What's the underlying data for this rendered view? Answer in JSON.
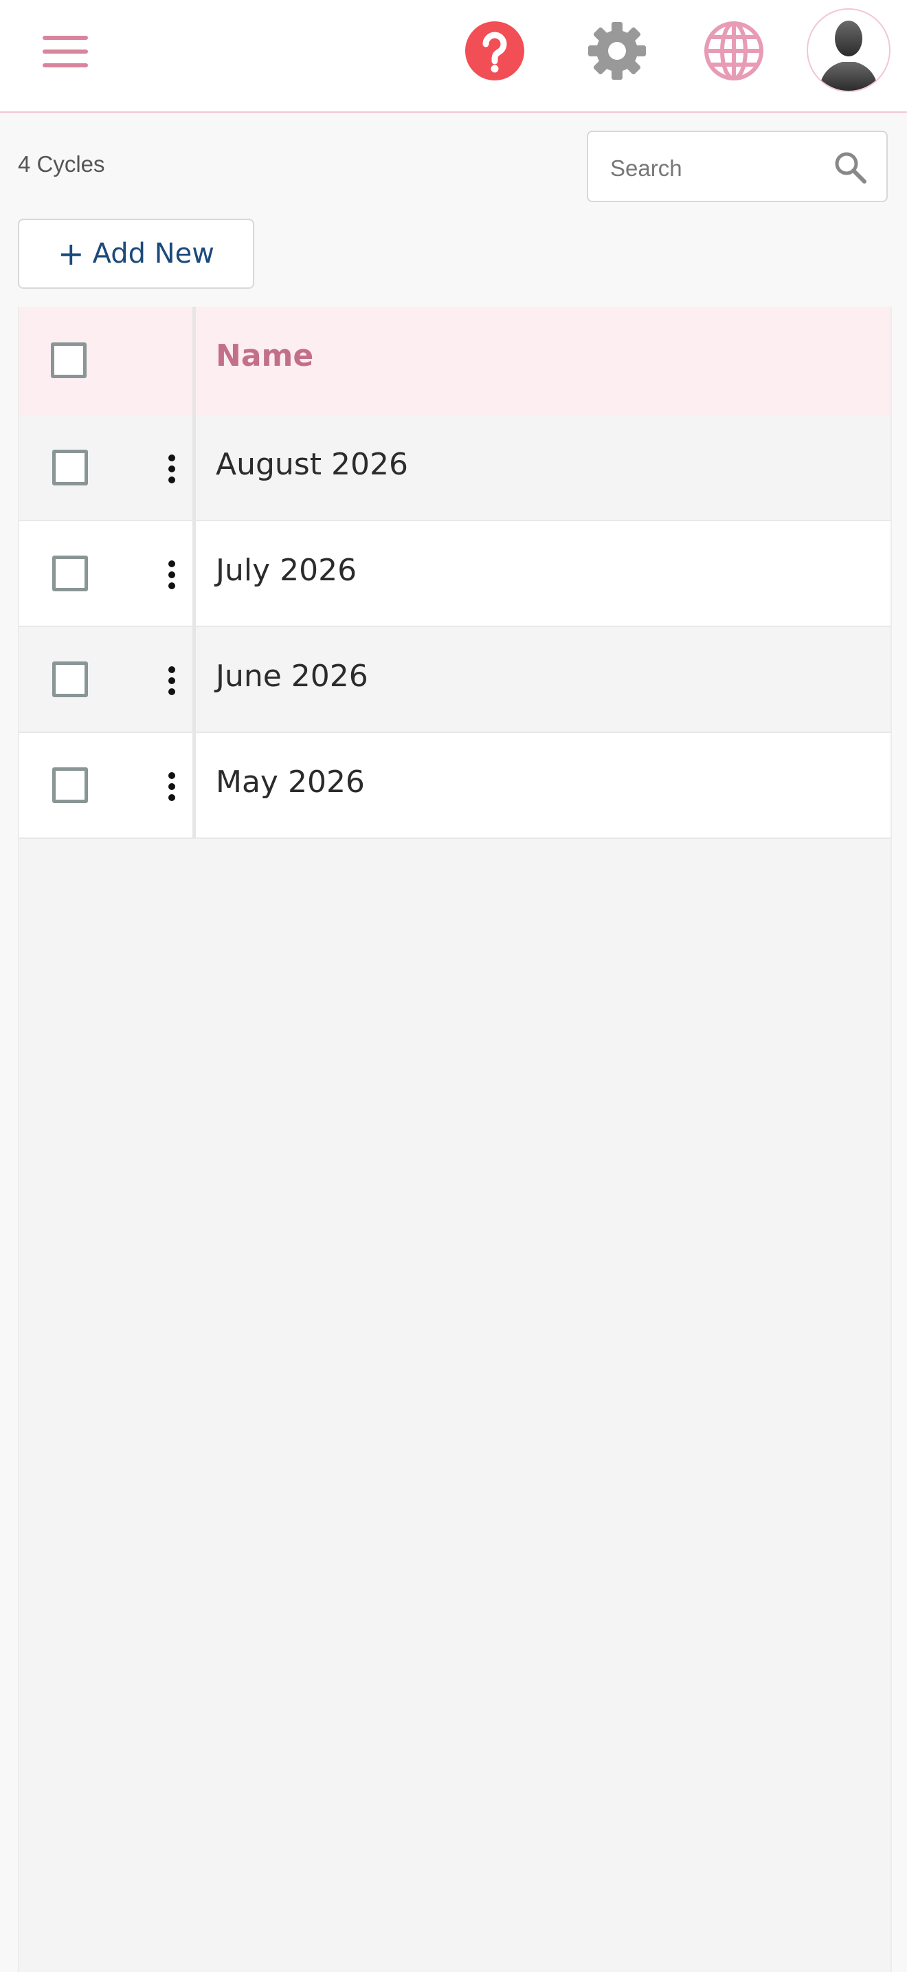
{
  "header": {
    "menu_icon": "hamburger-menu-icon",
    "help_icon": "help-circle-icon",
    "settings_icon": "gear-icon",
    "language_icon": "globe-icon",
    "avatar_icon": "user-avatar-icon",
    "colors": {
      "accent": "#d9849d",
      "help": "#f24e55",
      "gear": "#999999",
      "globe": "#e89bb4"
    }
  },
  "toolbar": {
    "count_label": "4 Cycles",
    "search_placeholder": "Search",
    "add_new_plus": "+",
    "add_new_label": "Add New"
  },
  "table": {
    "column_name": "Name",
    "rows": [
      {
        "name": "August 2026"
      },
      {
        "name": "July 2026"
      },
      {
        "name": "June 2026"
      },
      {
        "name": "May 2026"
      }
    ]
  }
}
